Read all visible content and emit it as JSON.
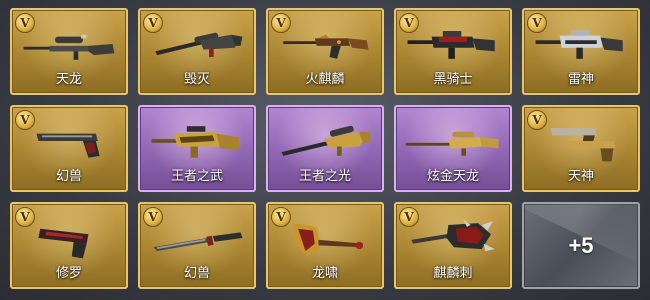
{
  "weapons": [
    {
      "name": "天龙",
      "rarity": "gold",
      "icon": "sniper-rifle-icon",
      "badge": "V"
    },
    {
      "name": "毁灭",
      "rarity": "gold",
      "icon": "heavy-sniper-icon",
      "badge": "V"
    },
    {
      "name": "火麒麟",
      "rarity": "gold",
      "icon": "ak-rifle-icon",
      "badge": "V"
    },
    {
      "name": "黑骑士",
      "rarity": "gold",
      "icon": "m4-rifle-red-icon",
      "badge": "V"
    },
    {
      "name": "雷神",
      "rarity": "gold",
      "icon": "m4-rifle-silver-icon",
      "badge": "V"
    },
    {
      "name": "幻兽",
      "rarity": "gold",
      "icon": "pistol-icon",
      "badge": "V"
    },
    {
      "name": "王者之武",
      "rarity": "purple",
      "icon": "gold-rifle-icon"
    },
    {
      "name": "王者之光",
      "rarity": "purple",
      "icon": "gold-sniper-icon"
    },
    {
      "name": "炫金天龙",
      "rarity": "purple",
      "icon": "gold-long-sniper-icon"
    },
    {
      "name": "天神",
      "rarity": "gold",
      "icon": "dual-pistols-icon",
      "badge": "V"
    },
    {
      "name": "修罗",
      "rarity": "gold",
      "icon": "red-pistol-icon",
      "badge": "V"
    },
    {
      "name": "幻兽",
      "rarity": "gold",
      "icon": "knife-icon",
      "badge": "V"
    },
    {
      "name": "龙啸",
      "rarity": "gold",
      "icon": "dragon-axe-icon",
      "badge": "V"
    },
    {
      "name": "麒麟刺",
      "rarity": "gold",
      "icon": "claw-blade-icon",
      "badge": "V"
    }
  ],
  "more_tile": {
    "label": "+5"
  },
  "colors": {
    "gold": "#b08a38",
    "purple": "#9a6fbd",
    "silver": "#5a5e67"
  }
}
